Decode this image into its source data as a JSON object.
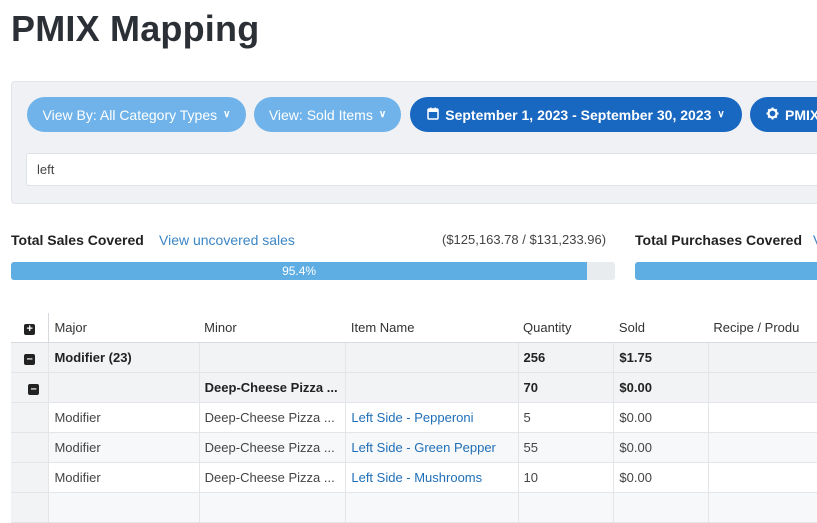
{
  "page": {
    "title": "PMIX Mapping"
  },
  "filters": {
    "view_by": "View By: All Category Types",
    "view": "View: Sold Items",
    "date_range": "September 1, 2023 - September 30, 2023",
    "pmix": "PMIX",
    "search_value": "left"
  },
  "coverage": {
    "sales": {
      "title": "Total Sales Covered",
      "link": "View uncovered sales",
      "amount": "($125,163.78 / $131,233.96)",
      "percent_label": "95.4%",
      "percent": 95.4
    },
    "purchases": {
      "title": "Total Purchases Covered",
      "link": "V"
    }
  },
  "table": {
    "columns": [
      "Major",
      "Minor",
      "Item Name",
      "Quantity",
      "Sold",
      "Recipe / Produ"
    ],
    "rows": [
      {
        "type": "group",
        "major": "Modifier (23)",
        "minor": "",
        "item": "",
        "quantity": "256",
        "sold": "$1.75",
        "recipe": ""
      },
      {
        "type": "subgroup",
        "major": "",
        "minor": "Deep-Cheese Pizza ...",
        "item": "",
        "quantity": "70",
        "sold": "$0.00",
        "recipe": ""
      },
      {
        "type": "item",
        "major": "Modifier",
        "minor": "Deep-Cheese Pizza ...",
        "item": "Left Side - Pepperoni",
        "quantity": "5",
        "sold": "$0.00",
        "recipe": ""
      },
      {
        "type": "item",
        "major": "Modifier",
        "minor": "Deep-Cheese Pizza ...",
        "item": "Left Side - Green Pepper",
        "quantity": "55",
        "sold": "$0.00",
        "recipe": ""
      },
      {
        "type": "item",
        "major": "Modifier",
        "minor": "Deep-Cheese Pizza ...",
        "item": "Left Side - Mushrooms",
        "quantity": "10",
        "sold": "$0.00",
        "recipe": ""
      }
    ]
  },
  "icons": {
    "expand_all": "plus-square-icon",
    "collapse": "minus-square-icon",
    "calendar": "calendar-icon",
    "gear": "gear-icon",
    "chevron": "chevron-down-icon"
  },
  "colors": {
    "pill_light": "#6fb3ea",
    "pill_dark": "#1867c0",
    "progress": "#5eaee3",
    "link": "#1f6fb8"
  }
}
